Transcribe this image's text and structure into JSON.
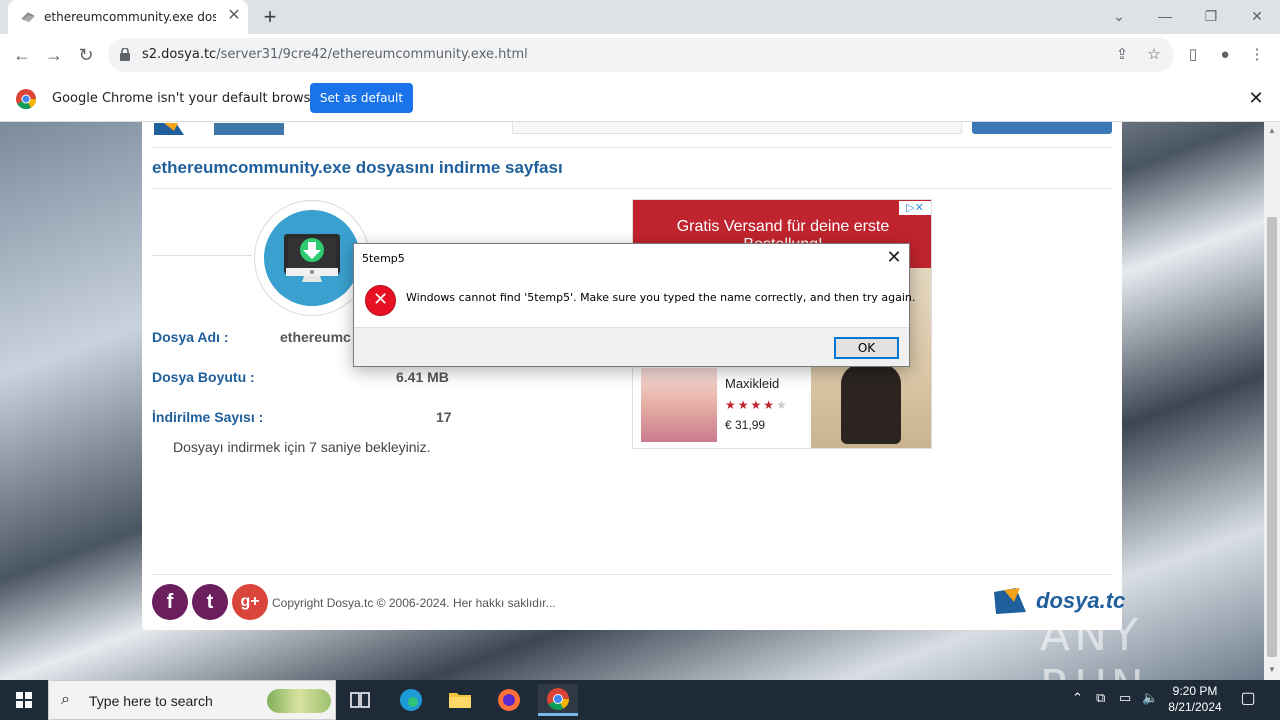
{
  "browser": {
    "tab_title": "ethereumcommunity.exe dosyasını indirme sayfası",
    "url_host": "s2.dosya.tc",
    "url_path": "/server31/9cre42/ethereumcommunity.exe.html",
    "infobar_message": "Google Chrome isn't your default browser",
    "infobar_button": "Set as default"
  },
  "page": {
    "heading": "ethereumcommunity.exe dosyasını indirme sayfası",
    "fields": [
      {
        "label": "Dosya Adı :",
        "value": "ethereumc"
      },
      {
        "label": "Dosya Boyutu :",
        "value": "6.41 MB"
      },
      {
        "label": "İndirilme Sayısı :",
        "value": "17"
      }
    ],
    "wait_message": "Dosyayı indirmek için 7 saniye bekleyiniz.",
    "copyright": "Copyright Dosya.tc © 2006-2024. Her hakkı saklıdır...",
    "footer_logo": "dosya.tc"
  },
  "ad": {
    "banner": "Gratis Versand für deine erste Bestellung!",
    "product": "Maxikleid",
    "rating": 4,
    "rating_max": 5,
    "price": "€ 31,99"
  },
  "dialog": {
    "title": "5temp5",
    "message": "Windows cannot find '5temp5'. Make sure you typed the name correctly, and then try again.",
    "ok_label": "OK"
  },
  "taskbar": {
    "search_placeholder": "Type here to search",
    "time": "9:20 PM",
    "date": "8/21/2024"
  },
  "watermark": "ANY RUN"
}
